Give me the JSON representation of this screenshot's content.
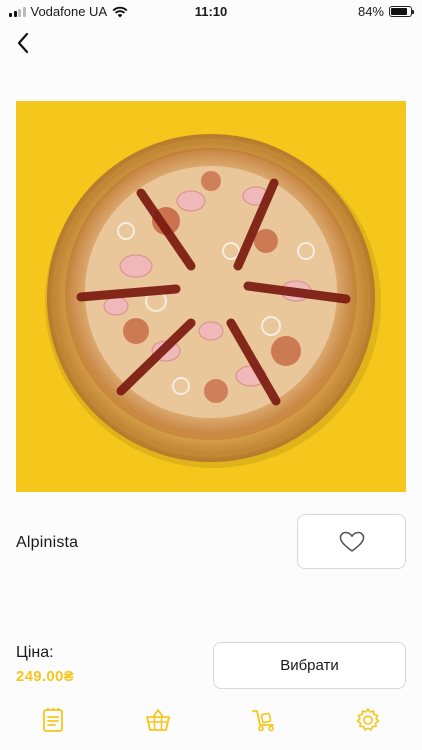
{
  "status_bar": {
    "carrier": "Vodafone UA",
    "time": "11:10",
    "battery_percent": "84%",
    "battery_level": 0.84
  },
  "nav": {
    "back_icon": "chevron-left-icon"
  },
  "product": {
    "name": "Alpinista",
    "image_icon": "pizza-photo",
    "image_bg": "#f5c61c"
  },
  "favorite": {
    "icon": "heart-outline-icon"
  },
  "price": {
    "label": "Ціна:",
    "value": "249.00₴",
    "color": "#f5c61c"
  },
  "select_button": {
    "label": "Вибрати"
  },
  "tab_bar": {
    "items": [
      {
        "icon": "menu-list-icon"
      },
      {
        "icon": "basket-icon"
      },
      {
        "icon": "delivery-cart-icon"
      },
      {
        "icon": "settings-gear-icon"
      }
    ],
    "icon_color": "#f5c61c"
  }
}
